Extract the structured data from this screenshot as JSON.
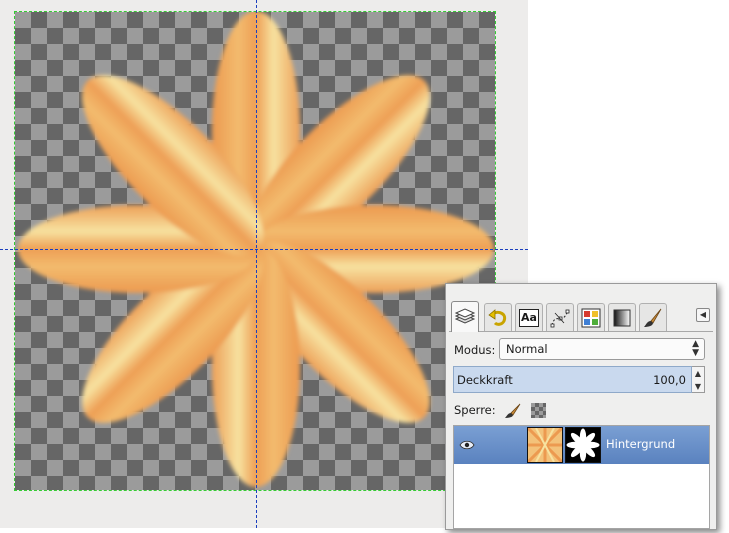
{
  "dock": {
    "tabs": [
      {
        "id": "layers",
        "icon": "layers-icon",
        "active": true
      },
      {
        "id": "undo",
        "icon": "undo-history-icon",
        "active": false
      },
      {
        "id": "fonts",
        "icon": "fonts-icon",
        "label": "Aa",
        "active": false
      },
      {
        "id": "paths",
        "icon": "paths-icon",
        "active": false
      },
      {
        "id": "colormap",
        "icon": "color-palette-icon",
        "active": false
      },
      {
        "id": "gradients",
        "icon": "gradient-icon",
        "active": false
      },
      {
        "id": "brushes",
        "icon": "brush-icon",
        "active": false
      }
    ],
    "menu_icon": "◀"
  },
  "layers": {
    "mode_label": "Modus:",
    "mode_value": "Normal",
    "opacity_label": "Deckkraft",
    "opacity_value": "100,0",
    "lock_label": "Sperre:",
    "items": [
      {
        "name": "Hintergrund",
        "visible": true,
        "selected": true
      }
    ]
  },
  "colors": {
    "selection_blue": "#6a90c9",
    "petal_light": "#f7e2a0",
    "petal_dark": "#ec9a50",
    "guide": "#1a3fbf"
  }
}
